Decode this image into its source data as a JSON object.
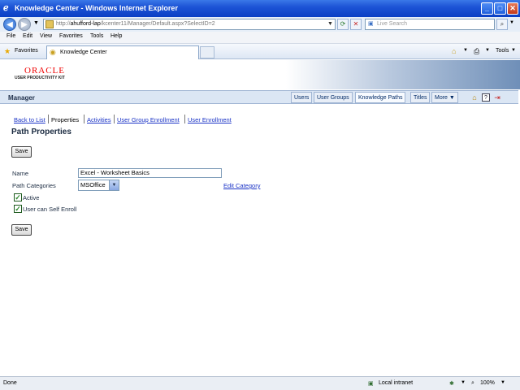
{
  "window": {
    "title": "Knowledge Center - Windows Internet Explorer",
    "buttons": {
      "minimize": "_",
      "maximize": "□",
      "close": "✕"
    }
  },
  "browser": {
    "back": "◀",
    "forward": "▶",
    "address_prefix": "http://",
    "address_host": "ahufford-lap",
    "address_path": "/kcenter11/Manager/Default.aspx?SelectID=2",
    "search_placeholder": "Live Search",
    "menu": [
      "File",
      "Edit",
      "View",
      "Favorites",
      "Tools",
      "Help"
    ],
    "favorites_label": "Favorites",
    "tab_label": "Knowledge Center",
    "tools_label": "Tools"
  },
  "header": {
    "oracle": "ORACLE",
    "upk": "USER PRODUCTIVITY KIT"
  },
  "manager": {
    "title": "Manager",
    "tabs": [
      "Users",
      "User Groups",
      "Knowledge Paths",
      "Titles",
      "More ▼"
    ],
    "active_tab": "Knowledge Paths"
  },
  "subnav": {
    "back": "Back to List",
    "properties": "Properties",
    "activities": "Activities",
    "group_enroll": "User Group Enrollment",
    "user_enroll": "User Enrollment"
  },
  "page": {
    "title": "Path Properties",
    "save": "Save",
    "name_label": "Name",
    "name_value": "Excel - Worksheet Basics",
    "cat_label": "Path Categories",
    "cat_value": "MSOffice",
    "edit_category": "Edit Category",
    "active_label": "Active",
    "active_checked": true,
    "self_enroll_label": "User can Self Enroll",
    "self_enroll_checked": true
  },
  "status": {
    "text": "Done",
    "zone": "Local intranet",
    "zoom": "100%"
  },
  "colors": {
    "titlebar": "#1d54d6",
    "link": "#1a33c6",
    "oracle_red": "#e00000"
  }
}
